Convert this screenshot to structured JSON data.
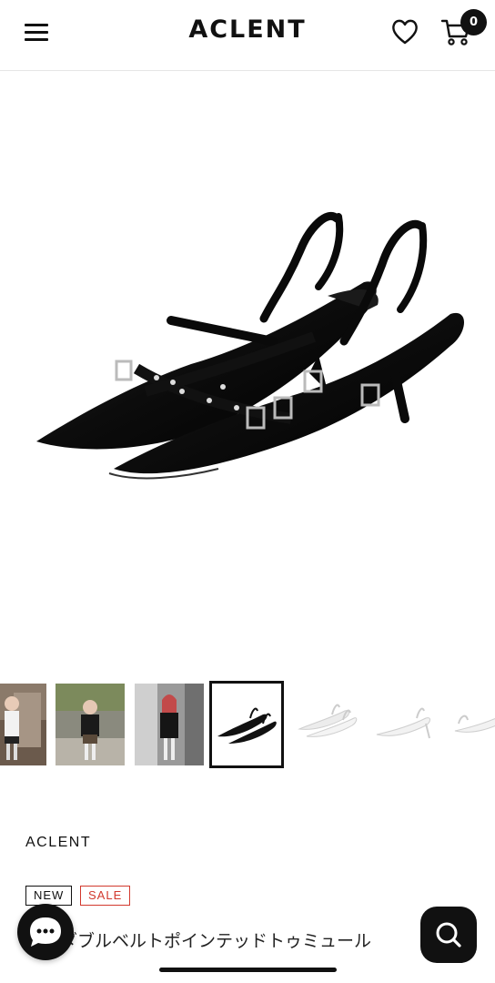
{
  "header": {
    "logo": "ACLENT",
    "cart_count": "0"
  },
  "product": {
    "brand": "ACLENT",
    "badges": {
      "new": "NEW",
      "sale": "SALE"
    },
    "title_visible": "ダブルベルトポインテッドトゥミュール",
    "selected_thumbnail_index": 3,
    "thumbnail_count_visible": 7
  },
  "icons": {
    "menu": "hamburger-icon",
    "wishlist": "heart-icon",
    "cart": "cart-icon",
    "chat": "chat-icon",
    "search": "search-icon"
  },
  "colors": {
    "primary": "#111111",
    "sale": "#d2392e",
    "divider": "#e6e6e6"
  }
}
